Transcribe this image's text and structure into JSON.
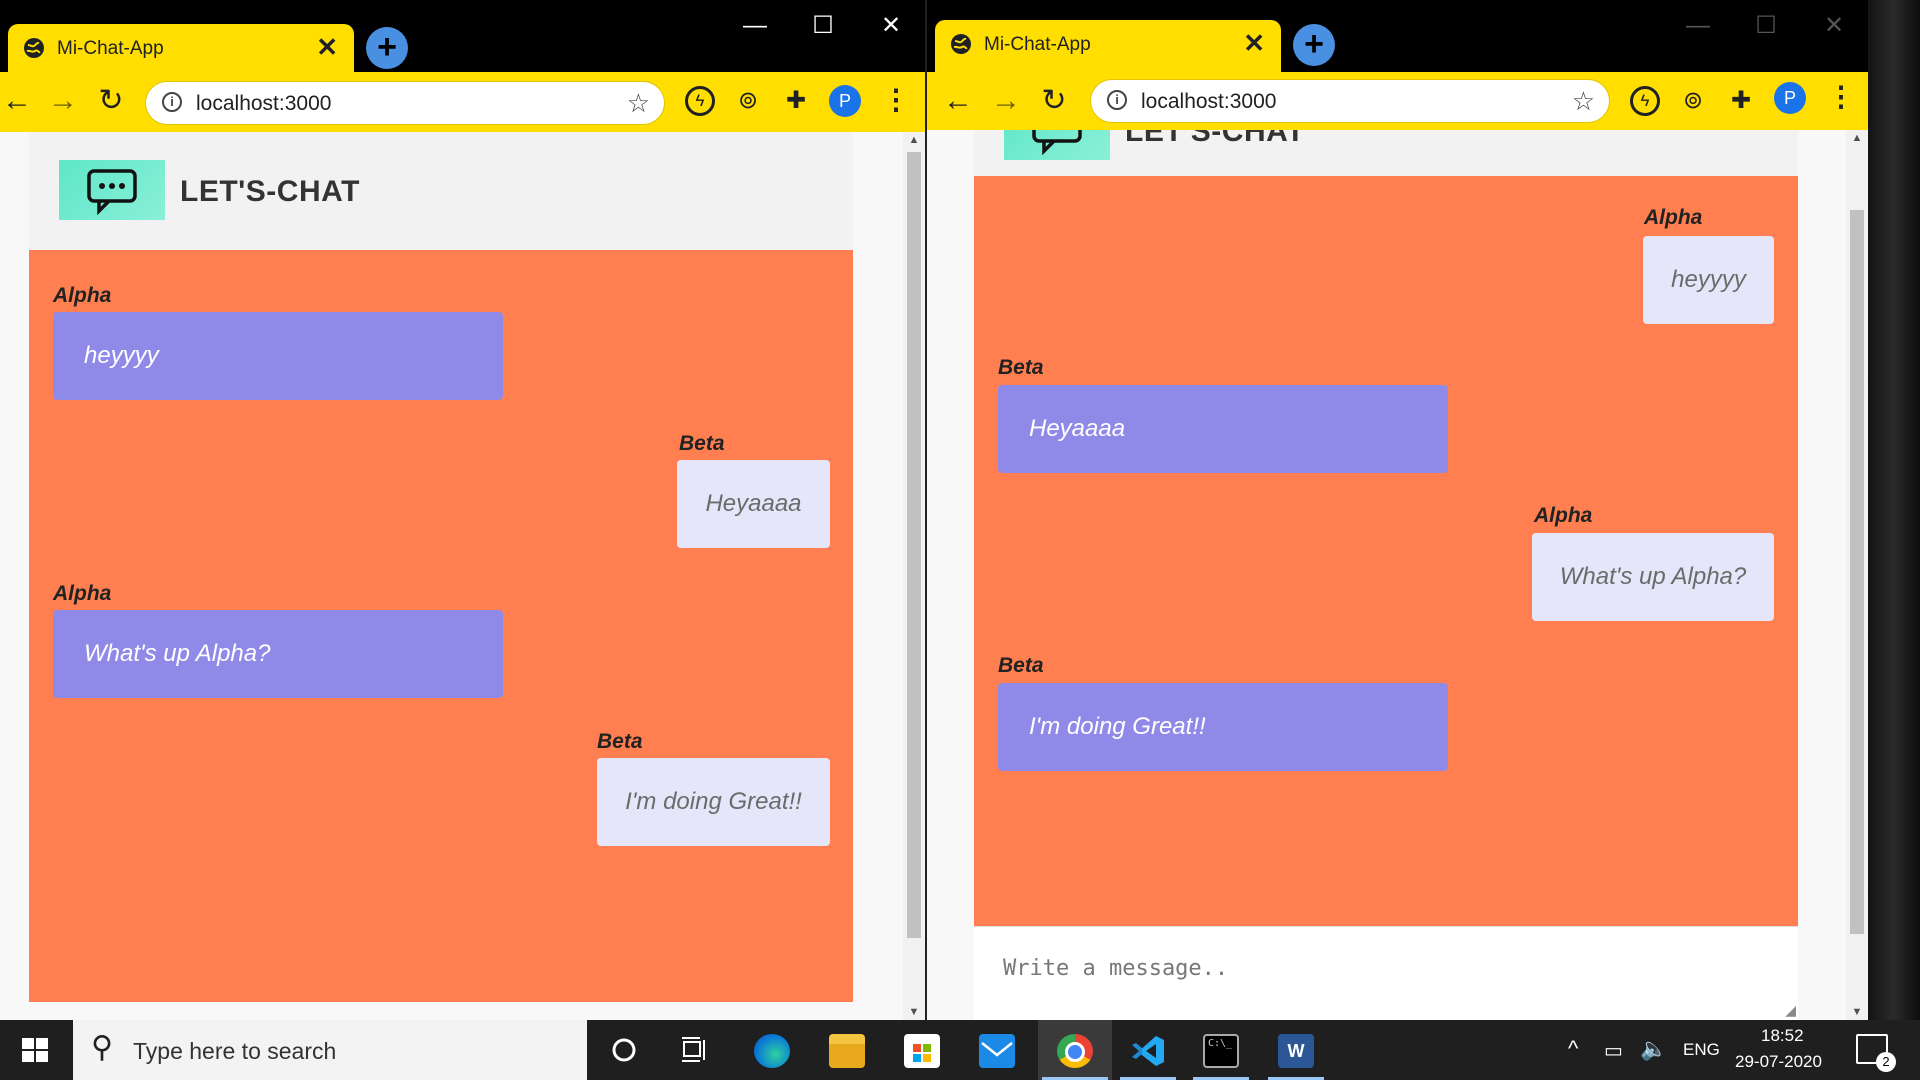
{
  "browser": {
    "tab_title": "Mi-Chat-App",
    "tab_close": "✕",
    "new_tab": "+",
    "url": "localhost:3000",
    "win_minimize": "—",
    "win_maximize": "☐",
    "win_close": "✕",
    "profile_initial": "P"
  },
  "app": {
    "brand": "LET'S-CHAT",
    "brand_partial": "LET'S-CHAT",
    "composer_placeholder": "Write a message.."
  },
  "left_view": {
    "messages": [
      {
        "sender": "Alpha",
        "text": "heyyyy",
        "side": "left"
      },
      {
        "sender": "Beta",
        "text": "Heyaaaa",
        "side": "right"
      },
      {
        "sender": "Alpha",
        "text": "What's up Alpha?",
        "side": "left"
      },
      {
        "sender": "Beta",
        "text": "I'm doing Great!!",
        "side": "right"
      }
    ]
  },
  "right_view": {
    "messages": [
      {
        "sender": "Alpha",
        "text": "heyyyy",
        "side": "right"
      },
      {
        "sender": "Beta",
        "text": "Heyaaaa",
        "side": "left"
      },
      {
        "sender": "Alpha",
        "text": "What's up Alpha?",
        "side": "right"
      },
      {
        "sender": "Beta",
        "text": "I'm doing Great!!",
        "side": "left"
      }
    ]
  },
  "taskbar": {
    "search_placeholder": "Type here to search",
    "language": "ENG",
    "time": "18:52",
    "date": "29-07-2020",
    "notification_count": "2"
  },
  "colors": {
    "chrome_yellow": "#ffde00",
    "chat_background": "#ff7f50",
    "own_bubble": "#8f8ae8",
    "other_bubble": "#e6e6fa"
  }
}
